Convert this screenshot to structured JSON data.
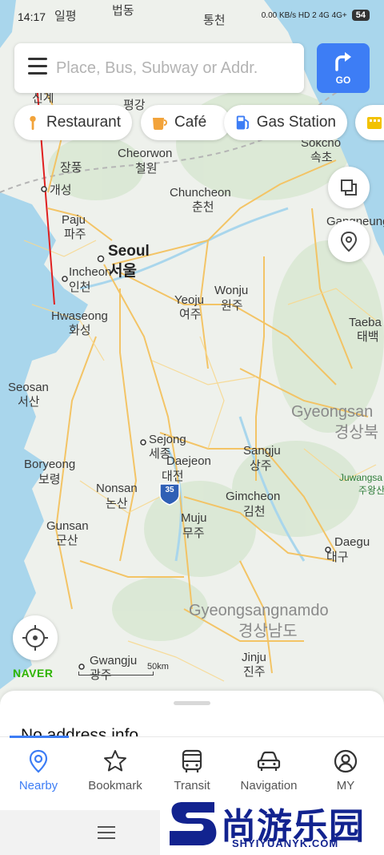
{
  "status_bar": {
    "time": "14:17",
    "indicators": "0.00 KB/s  HD 2  4G  4G+",
    "battery": "54"
  },
  "search": {
    "placeholder": "Place, Bus, Subway or Addr.",
    "go_label": "GO",
    "icons": {
      "menu": "hamburger-menu-icon",
      "go": "turn-right-arrow-icon"
    }
  },
  "chips": [
    {
      "label": "Restaurant",
      "icon": "fork-icon",
      "color": "#f2a33a"
    },
    {
      "label": "Café",
      "icon": "coffee-cup-icon",
      "color": "#f2a33a"
    },
    {
      "label": "Gas Station",
      "icon": "gas-pump-icon",
      "color": "#3d7df5"
    },
    {
      "label": "",
      "icon": "more-category-icon",
      "color": "#f2c200"
    }
  ],
  "map": {
    "labels": [
      {
        "text": "일평",
        "kind": "small"
      },
      {
        "text": "법동",
        "kind": "small"
      },
      {
        "text": "통천",
        "kind": "small"
      },
      {
        "text": "신계",
        "kind": "small"
      },
      {
        "text": "평강",
        "kind": "small"
      },
      {
        "text": "Sokcho",
        "kind": "small"
      },
      {
        "text": "속초",
        "kind": "small"
      },
      {
        "text": "Cheorwon",
        "kind": "small"
      },
      {
        "text": "철원",
        "kind": "small"
      },
      {
        "text": "장풍",
        "kind": "small"
      },
      {
        "text": "개성",
        "kind": "small"
      },
      {
        "text": "Chuncheon",
        "kind": "small"
      },
      {
        "text": "춘천",
        "kind": "small"
      },
      {
        "text": "Paju",
        "kind": "small"
      },
      {
        "text": "파주",
        "kind": "small"
      },
      {
        "text": "Gangneung",
        "kind": "small"
      },
      {
        "text": "Seoul",
        "kind": "big"
      },
      {
        "text": "서울",
        "kind": "big"
      },
      {
        "text": "Incheon",
        "kind": "small"
      },
      {
        "text": "인천",
        "kind": "small"
      },
      {
        "text": "Wonju",
        "kind": "small"
      },
      {
        "text": "원주",
        "kind": "small"
      },
      {
        "text": "Yeoju",
        "kind": "small"
      },
      {
        "text": "여주",
        "kind": "small"
      },
      {
        "text": "Hwaseong",
        "kind": "small"
      },
      {
        "text": "화성",
        "kind": "small"
      },
      {
        "text": "Taeba",
        "kind": "small"
      },
      {
        "text": "태백",
        "kind": "small"
      },
      {
        "text": "Seosan",
        "kind": "small"
      },
      {
        "text": "서산",
        "kind": "small"
      },
      {
        "text": "Gyeongsan",
        "kind": "region"
      },
      {
        "text": "경상북",
        "kind": "region"
      },
      {
        "text": "Sejong",
        "kind": "small"
      },
      {
        "text": "세종",
        "kind": "small"
      },
      {
        "text": "Daejeon",
        "kind": "small"
      },
      {
        "text": "대전",
        "kind": "small"
      },
      {
        "text": "Sangju",
        "kind": "small"
      },
      {
        "text": "상주",
        "kind": "small"
      },
      {
        "text": "Boryeong",
        "kind": "small"
      },
      {
        "text": "보령",
        "kind": "small"
      },
      {
        "text": "Juwangsa",
        "kind": "park"
      },
      {
        "text": "주왕산",
        "kind": "park"
      },
      {
        "text": "Nonsan",
        "kind": "small"
      },
      {
        "text": "논산",
        "kind": "small"
      },
      {
        "text": "Gimcheon",
        "kind": "small"
      },
      {
        "text": "김천",
        "kind": "small"
      },
      {
        "text": "35",
        "kind": "shield"
      },
      {
        "text": "Muju",
        "kind": "small"
      },
      {
        "text": "무주",
        "kind": "small"
      },
      {
        "text": "Gunsan",
        "kind": "small"
      },
      {
        "text": "군산",
        "kind": "small"
      },
      {
        "text": "Daegu",
        "kind": "small"
      },
      {
        "text": "대구",
        "kind": "small"
      },
      {
        "text": "Gyeongsangnamdo",
        "kind": "region"
      },
      {
        "text": "경상남도",
        "kind": "region"
      },
      {
        "text": "Gwangju",
        "kind": "small"
      },
      {
        "text": "광주",
        "kind": "small"
      },
      {
        "text": "Jinju",
        "kind": "small"
      },
      {
        "text": "진주",
        "kind": "small"
      }
    ],
    "scale_text": "50km",
    "logo": "NAVER",
    "side_buttons": {
      "layers": "layers-icon",
      "location_pin": "map-pin-icon",
      "my_location": "crosshair-location-icon"
    }
  },
  "sheet": {
    "address": "No address info"
  },
  "tabs": [
    {
      "label": "Nearby",
      "icon": "location-pin-icon",
      "active": true
    },
    {
      "label": "Bookmark",
      "icon": "star-icon",
      "active": false
    },
    {
      "label": "Transit",
      "icon": "bus-icon",
      "active": false
    },
    {
      "label": "Navigation",
      "icon": "car-icon",
      "active": false
    },
    {
      "label": "MY",
      "icon": "person-circle-icon",
      "active": false
    }
  ],
  "colors": {
    "accent": "#3d7df5",
    "sea": "#a9d6ec",
    "land": "#eef1ec",
    "road": "#f4c25f",
    "annotation_arrow": "#e02020"
  },
  "watermark": {
    "chinese": "尚游乐园",
    "domain": "SHYIYUANYK.COM"
  }
}
